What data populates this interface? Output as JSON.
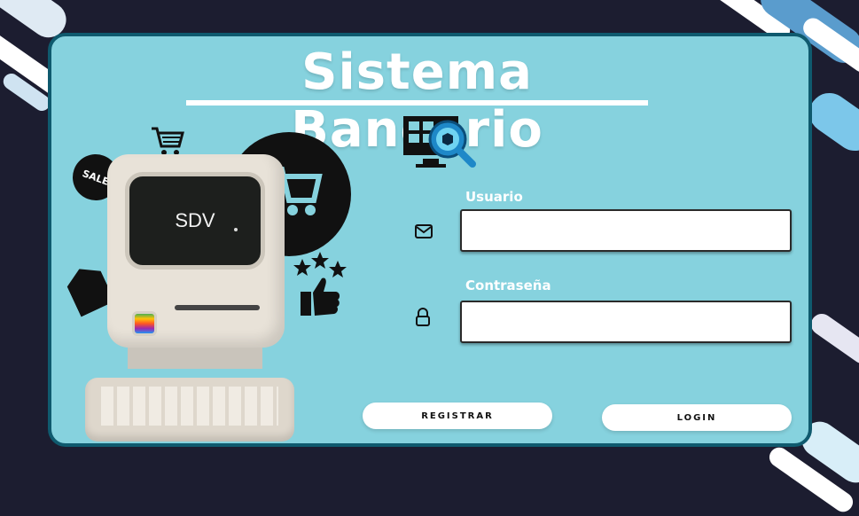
{
  "header": {
    "title": "Sistema Bancario"
  },
  "computer": {
    "screen_text": "SDV",
    "sticker_text": "SALE"
  },
  "form": {
    "user": {
      "label": "Usuario",
      "value": "",
      "placeholder": ""
    },
    "password": {
      "label": "Contraseña",
      "value": "",
      "placeholder": ""
    }
  },
  "buttons": {
    "register": "REGISTRAR",
    "login": "LOGIN"
  },
  "colors": {
    "background": "#1c1d30",
    "card": "#86d2de",
    "card_border": "#0f5a6e",
    "accent_blue": "#1e88c8"
  },
  "icons": [
    "monitor-search-icon",
    "mail-icon",
    "lock-icon",
    "shopping-cart-icon",
    "star-rating-icon"
  ]
}
